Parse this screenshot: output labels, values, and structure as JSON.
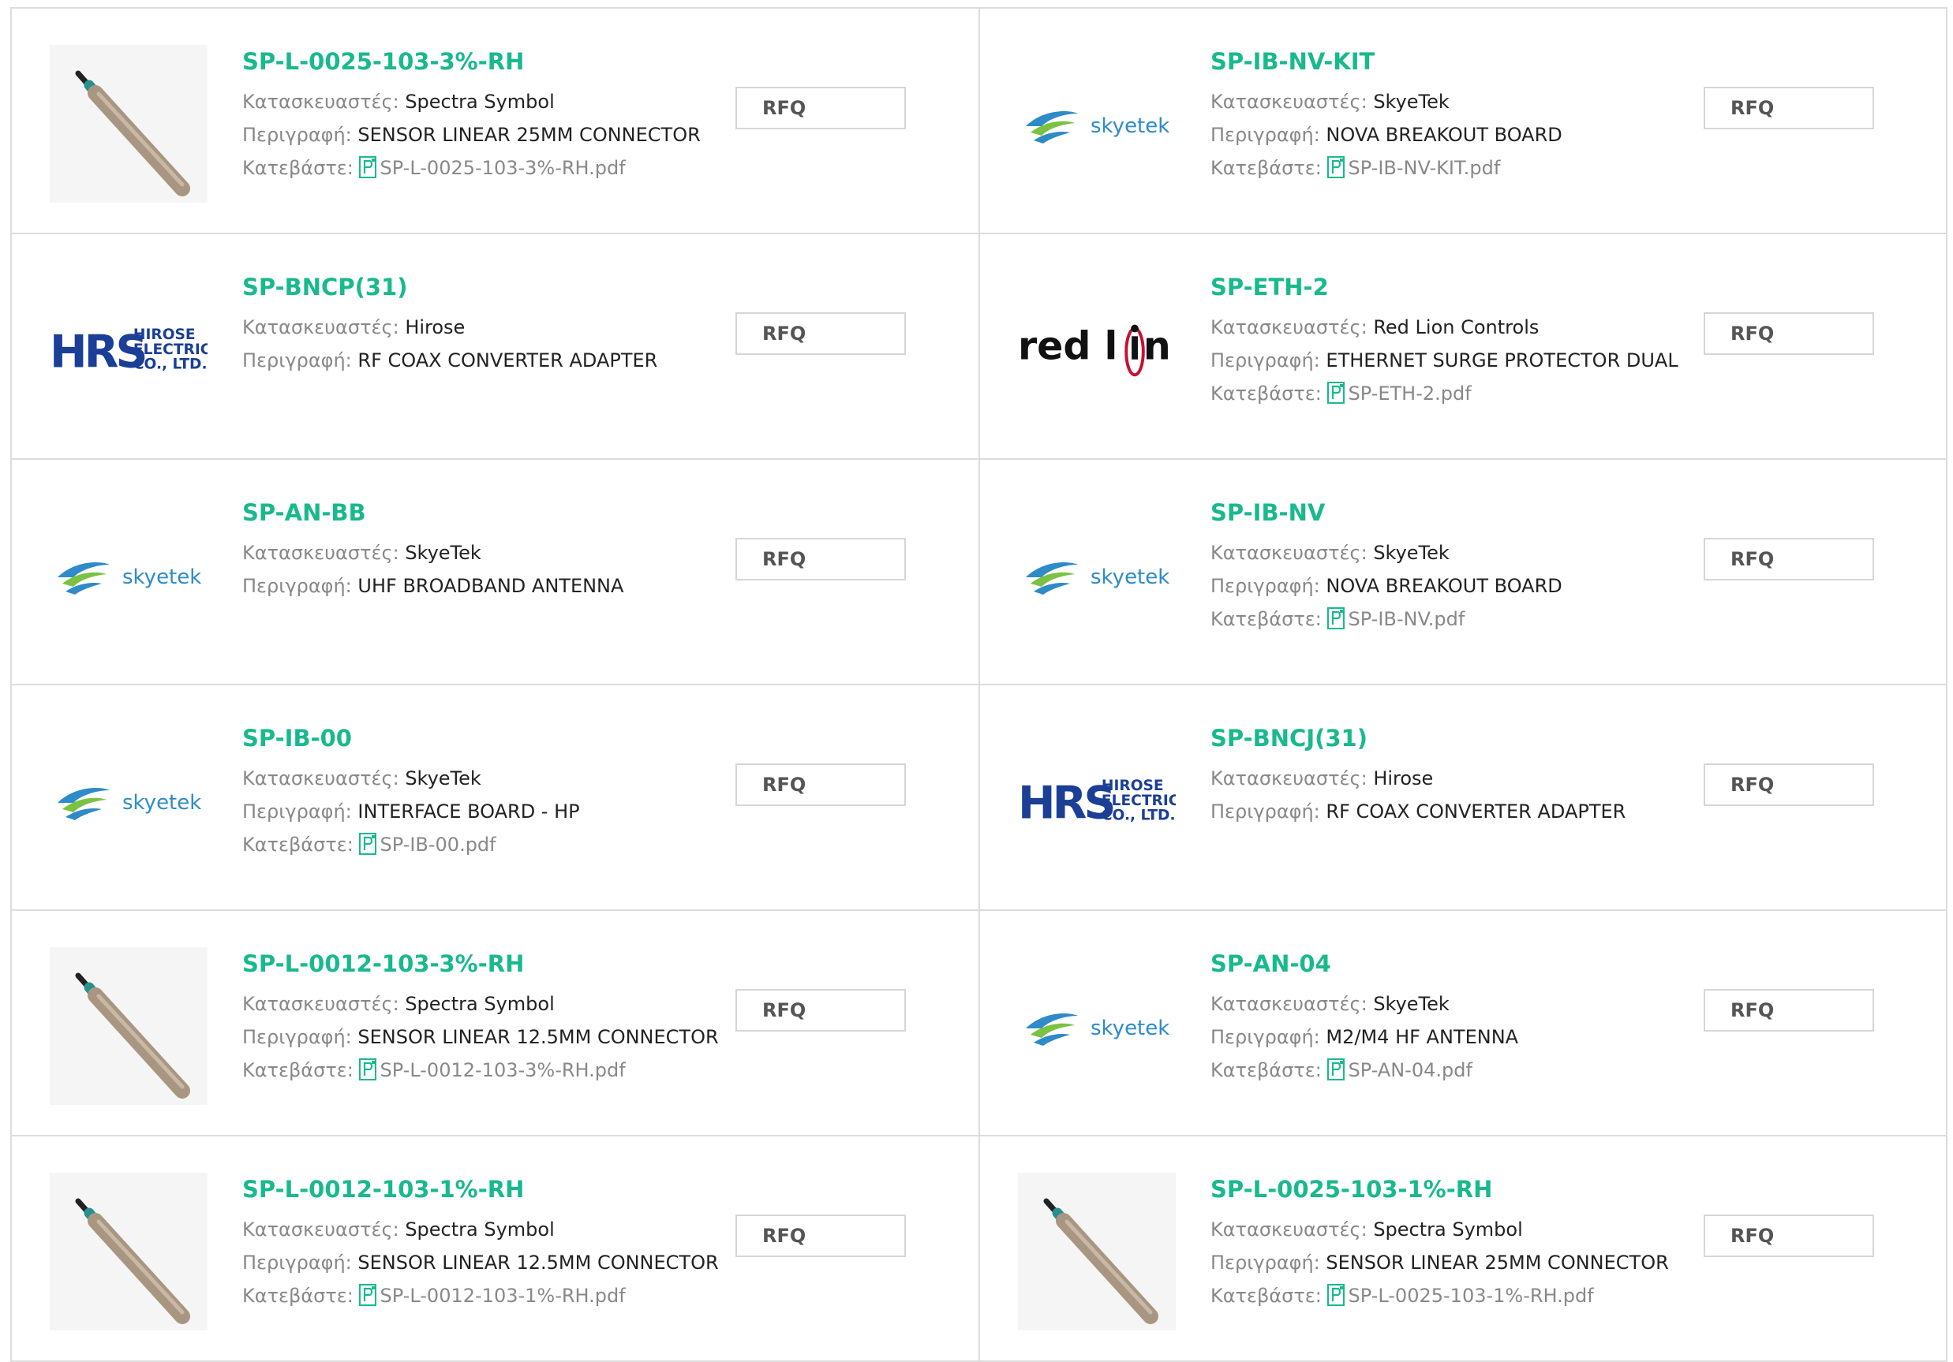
{
  "labels": {
    "manufacturer": "Κατασκευαστές:",
    "description": "Περιγραφή:",
    "download": "Κατεβάστε:",
    "rfq": "RFQ"
  },
  "colors": {
    "accent": "#19b98e",
    "border": "#dcdcdc",
    "label": "#888888",
    "value": "#222222"
  },
  "products": [
    {
      "part": "SP-L-0025-103-3%-RH",
      "manufacturer": "Spectra Symbol",
      "description": "SENSOR LINEAR 25MM CONNECTOR",
      "file": "SP-L-0025-103-3%-RH.pdf",
      "image": "sensor-rod-image"
    },
    {
      "part": "SP-IB-NV-KIT",
      "manufacturer": "SkyeTek",
      "description": "NOVA BREAKOUT BOARD",
      "file": "SP-IB-NV-KIT.pdf",
      "image": "skyetek-logo"
    },
    {
      "part": "SP-BNCP(31)",
      "manufacturer": "Hirose",
      "description": "RF COAX CONVERTER ADAPTER",
      "file": null,
      "image": "hirose-logo",
      "logo_text": [
        "HIROSE",
        "ELECTRIC",
        "CO., LTD."
      ]
    },
    {
      "part": "SP-ETH-2",
      "manufacturer": "Red Lion Controls",
      "description": "ETHERNET SURGE PROTECTOR DUAL",
      "file": "SP-ETH-2.pdf",
      "image": "redlion-logo"
    },
    {
      "part": "SP-AN-BB",
      "manufacturer": "SkyeTek",
      "description": "UHF BROADBAND ANTENNA",
      "file": null,
      "image": "skyetek-logo"
    },
    {
      "part": "SP-IB-NV",
      "manufacturer": "SkyeTek",
      "description": "NOVA BREAKOUT BOARD",
      "file": "SP-IB-NV.pdf",
      "image": "skyetek-logo"
    },
    {
      "part": "SP-IB-00",
      "manufacturer": "SkyeTek",
      "description": "INTERFACE BOARD - HP",
      "file": "SP-IB-00.pdf",
      "image": "skyetek-logo"
    },
    {
      "part": "SP-BNCJ(31)",
      "manufacturer": "Hirose",
      "description": "RF COAX CONVERTER ADAPTER",
      "file": null,
      "image": "hirose-logo",
      "logo_text": [
        "HIROSE",
        "ELECTRIC",
        "CO., LTD."
      ]
    },
    {
      "part": "SP-L-0012-103-3%-RH",
      "manufacturer": "Spectra Symbol",
      "description": "SENSOR LINEAR 12.5MM CONNECTOR",
      "file": "SP-L-0012-103-3%-RH.pdf",
      "image": "sensor-rod-image"
    },
    {
      "part": "SP-AN-04",
      "manufacturer": "SkyeTek",
      "description": "M2/M4 HF ANTENNA",
      "file": "SP-AN-04.pdf",
      "image": "skyetek-logo"
    },
    {
      "part": "SP-L-0012-103-1%-RH",
      "manufacturer": "Spectra Symbol",
      "description": "SENSOR LINEAR 12.5MM CONNECTOR",
      "file": "SP-L-0012-103-1%-RH.pdf",
      "image": "sensor-rod-image"
    },
    {
      "part": "SP-L-0025-103-1%-RH",
      "manufacturer": "Spectra Symbol",
      "description": "SENSOR LINEAR 25MM CONNECTOR",
      "file": "SP-L-0025-103-1%-RH.pdf",
      "image": "sensor-rod-image"
    }
  ]
}
